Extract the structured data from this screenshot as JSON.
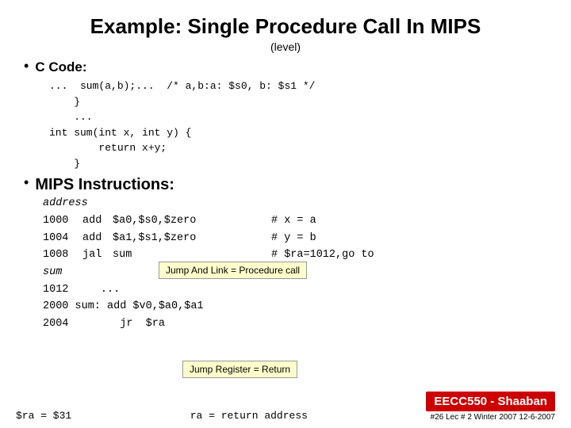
{
  "slide": {
    "title": "Example: Single Procedure Call In MIPS",
    "subtitle": "(level)",
    "bullet1": {
      "dot": "•",
      "label": "C Code:",
      "code_lines": [
        "...  sum(a,b);...  /* a,b:a: $s0, b: $s1 */",
        "}",
        "...",
        "int sum(int x, int y) {",
        "        return x+y;",
        "}"
      ]
    },
    "bullet2": {
      "dot": "•",
      "label": "MIPS Instructions:"
    },
    "address_header": "address",
    "mips_rows": [
      {
        "addr": "1000",
        "instr": "add",
        "operands": "$a0,$s0,$zero",
        "comment": "# x = a"
      },
      {
        "addr": "1004",
        "instr": "add",
        "operands": "$a1,$s1,$zero",
        "comment": "# y = b"
      },
      {
        "addr": "1008",
        "instr": "jal",
        "operands": "sum          ",
        "comment": "# $ra=1012,go to"
      }
    ],
    "italic_row": {
      "addr": "sum"
    },
    "row_1012": {
      "addr": "1012",
      "content": "..."
    },
    "row_2000": {
      "addr": "2000",
      "content": "sum:  add $v0,$a0,$a1"
    },
    "row_2004": {
      "addr": "2004",
      "content": "jr  $ra"
    },
    "bottom": {
      "sra_line": "$ra = $31",
      "ra_desc": "ra = return address",
      "jal_tooltip": "Jump And Link = Procedure call",
      "jr_tooltip": "Jump Register = Return",
      "eecc_label": "EECC550 - Shaaban",
      "footer_info": "#26  Lec # 2  Winter 2007  12-6-2007"
    }
  }
}
